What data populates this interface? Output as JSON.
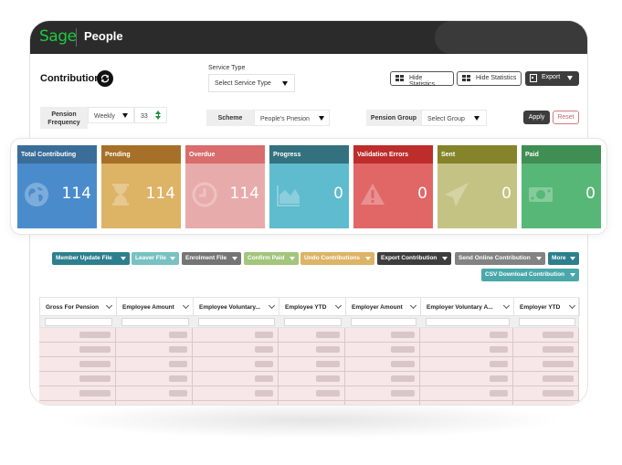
{
  "header": {
    "logo": "Sage",
    "app_name": "People"
  },
  "page": {
    "title": "Contribution",
    "refresh_icon": "refresh-icon"
  },
  "service_type": {
    "label": "Service Type",
    "value": "Select Service Type"
  },
  "toolbar": {
    "hide_statistics_1": "Hide Statistics",
    "hide_statistics_2": "Hide Statistics",
    "export": "Export"
  },
  "filters": {
    "pension_frequency_label": "Pension Frequency",
    "frequency_value": "Weekly",
    "period_value": "33",
    "scheme_label": "Scheme",
    "scheme_value": "People's Pnesion",
    "pension_group_label": "Pension Group",
    "pension_group_value": "Select Group",
    "apply": "Apply",
    "reset": "Reset"
  },
  "stats": [
    {
      "label": "Total Contributing",
      "value": "114",
      "icon": "globe-icon",
      "head_color": "#3a6e99",
      "body_color": "#4a8ccb"
    },
    {
      "label": "Pending",
      "value": "114",
      "icon": "hourglass-icon",
      "head_color": "#a77028",
      "body_color": "#ddb366"
    },
    {
      "label": "Overdue",
      "value": "114",
      "icon": "clock-icon",
      "head_color": "#d96c6c",
      "body_color": "#e8abab"
    },
    {
      "label": "Progress",
      "value": "0",
      "icon": "area-chart-icon",
      "head_color": "#33717f",
      "body_color": "#5fbbce"
    },
    {
      "label": "Validation Errors",
      "value": "0",
      "icon": "warning-icon",
      "head_color": "#bd2d2b",
      "body_color": "#e16767"
    },
    {
      "label": "Sent",
      "value": "0",
      "icon": "paper-plane-icon",
      "head_color": "#85842a",
      "body_color": "#c5c383"
    },
    {
      "label": "Paid",
      "value": "0",
      "icon": "money-icon",
      "head_color": "#3f8e53",
      "body_color": "#57b776"
    }
  ],
  "actions": [
    {
      "label": "Member Update File",
      "color": "#2d7f8e"
    },
    {
      "label": "Leaver File",
      "color": "#79c1c2"
    },
    {
      "label": "Enrolment File",
      "color": "#757575"
    },
    {
      "label": "Confirm Paid",
      "color": "#a3c57c"
    },
    {
      "label": "Undo Contributions",
      "color": "#ddb366"
    },
    {
      "label": "Export Contribution",
      "color": "#3d3d3d"
    },
    {
      "label": "Send Online Contribution",
      "color": "#838383"
    },
    {
      "label": "More",
      "color": "#2d7f8e"
    },
    {
      "label": "CSV Download Contribution",
      "color": "#4aa8ab"
    }
  ],
  "table": {
    "columns": [
      "Gross For Pension",
      "Employee Amount",
      "Employee Voluntary...",
      "Employee YTD",
      "Employer Amount",
      "Employer Voluntary A...",
      "Employer YTD"
    ],
    "row_count_visible": 6
  }
}
